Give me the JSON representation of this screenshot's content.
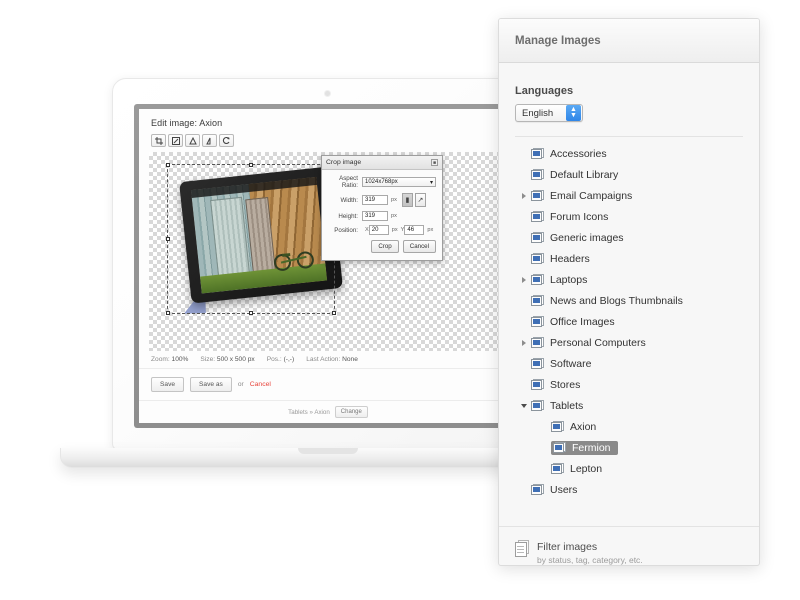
{
  "editor": {
    "title": "Edit image: Axion",
    "toolbar": [
      {
        "name": "crop-tool",
        "glyph": "✐"
      },
      {
        "name": "resize-tool",
        "glyph": "◱"
      },
      {
        "name": "rotate-left-tool",
        "glyph": "↺"
      },
      {
        "name": "flip-tool",
        "glyph": "⇄"
      },
      {
        "name": "reset-tool",
        "glyph": "↻"
      }
    ],
    "status": {
      "zoom_label": "Zoom:",
      "zoom_value": "100%",
      "size_label": "Size:",
      "size_value": "500 x 500 px",
      "pos_label": "Pos.:",
      "pos_value": "(-,-)",
      "last_action_label": "Last Action:",
      "last_action_value": "None"
    },
    "actions": {
      "save": "Save",
      "save_as": "Save as",
      "or": "or",
      "cancel": "Cancel"
    },
    "breadcrumb": {
      "path": "Tablets » Axion",
      "change": "Change"
    }
  },
  "crop_dialog": {
    "title": "Crop image",
    "close_glyph": "■",
    "aspect_ratio_label": "Aspect Ratio:",
    "aspect_ratio_value": "1024x768px",
    "width_label": "Width:",
    "width_value": "319",
    "height_label": "Height:",
    "height_value": "319",
    "position_label": "Position:",
    "x_label": "X",
    "x_value": "20",
    "y_label": "Y",
    "y_value": "46",
    "unit": "px",
    "lock_glyph": "▮",
    "free_glyph": "↗",
    "crop_button": "Crop",
    "cancel_button": "Cancel"
  },
  "panel": {
    "title": "Manage Images",
    "languages_label": "Languages",
    "language_value": "English",
    "tree": [
      {
        "label": "Accessories",
        "depth": 0,
        "toggle": "none",
        "selected": false
      },
      {
        "label": "Default Library",
        "depth": 0,
        "toggle": "none",
        "selected": false
      },
      {
        "label": "Email Campaigns",
        "depth": 0,
        "toggle": "collapsed",
        "selected": false
      },
      {
        "label": "Forum Icons",
        "depth": 0,
        "toggle": "none",
        "selected": false
      },
      {
        "label": "Generic images",
        "depth": 0,
        "toggle": "none",
        "selected": false
      },
      {
        "label": "Headers",
        "depth": 0,
        "toggle": "none",
        "selected": false
      },
      {
        "label": "Laptops",
        "depth": 0,
        "toggle": "collapsed",
        "selected": false
      },
      {
        "label": "News and Blogs Thumbnails",
        "depth": 0,
        "toggle": "none",
        "selected": false
      },
      {
        "label": "Office Images",
        "depth": 0,
        "toggle": "none",
        "selected": false
      },
      {
        "label": "Personal Computers",
        "depth": 0,
        "toggle": "collapsed",
        "selected": false
      },
      {
        "label": "Software",
        "depth": 0,
        "toggle": "none",
        "selected": false
      },
      {
        "label": "Stores",
        "depth": 0,
        "toggle": "none",
        "selected": false
      },
      {
        "label": "Tablets",
        "depth": 0,
        "toggle": "expanded",
        "selected": false
      },
      {
        "label": "Axion",
        "depth": 1,
        "toggle": "none",
        "selected": false
      },
      {
        "label": "Fermion",
        "depth": 1,
        "toggle": "none",
        "selected": true
      },
      {
        "label": "Lepton",
        "depth": 1,
        "toggle": "none",
        "selected": false
      },
      {
        "label": "Users",
        "depth": 0,
        "toggle": "none",
        "selected": false
      }
    ],
    "filter": {
      "title": "Filter images",
      "subtitle": "by status, tag, category, etc."
    }
  },
  "colors": {
    "accent_blue": "#2f86e8",
    "cancel_red": "#e8453c",
    "selection_gray": "#8a8a8a",
    "panel_bg": "#f7f7f7"
  }
}
